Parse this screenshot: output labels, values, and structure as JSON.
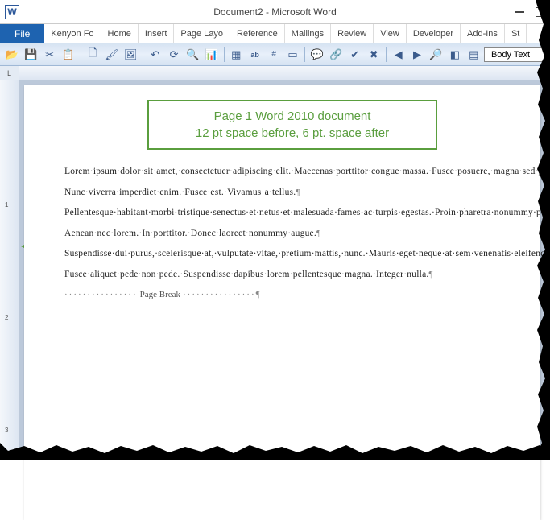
{
  "title": "Document2 - Microsoft Word",
  "menus": {
    "file": "File",
    "items": [
      "Kenyon Fo",
      "Home",
      "Insert",
      "Page Layo",
      "Reference",
      "Mailings",
      "Review",
      "View",
      "Developer",
      "Add-Ins",
      "St"
    ]
  },
  "style_selector": "Body Text",
  "ruler_corner": "L",
  "callout": {
    "line1": "Page 1 Word 2010 document",
    "line2": "12 pt space before, 6 pt. space after"
  },
  "paragraphs": [
    "Lorem·ipsum·dolor·sit·amet,·consectetuer·adipiscing·elit.·Maecenas·porttitor·congue·massa.·Fusce·posuere,·magna·sed·pulvinar·ultricies,·purus·lectus·malesuada·libero,·sit·amet·commodo·magna·eros·quis·urna.",
    "Nunc·viverra·imperdiet·enim.·Fusce·est.·Vivamus·a·tellus.",
    "Pellentesque·habitant·morbi·tristique·senectus·et·netus·et·malesuada·fames·ac·turpis·egestas.·Proin·pharetra·nonummy·pede.·Mauris·et·orci.",
    "Aenean·nec·lorem.·In·porttitor.·Donec·laoreet·nonummy·augue.",
    "Suspendisse·dui·purus,·scelerisque·at,·vulputate·vitae,·pretium·mattis,·nunc.·Mauris·eget·neque·at·sem·venenatis·eleifend.·Ut·nonummy.",
    "Fusce·aliquet·pede·non·pede.·Suspendisse·dapibus·lorem·pellentesque·magna.·Integer·nulla."
  ],
  "page_break_label": "Page Break",
  "vruler": [
    "1",
    "2",
    "3"
  ]
}
